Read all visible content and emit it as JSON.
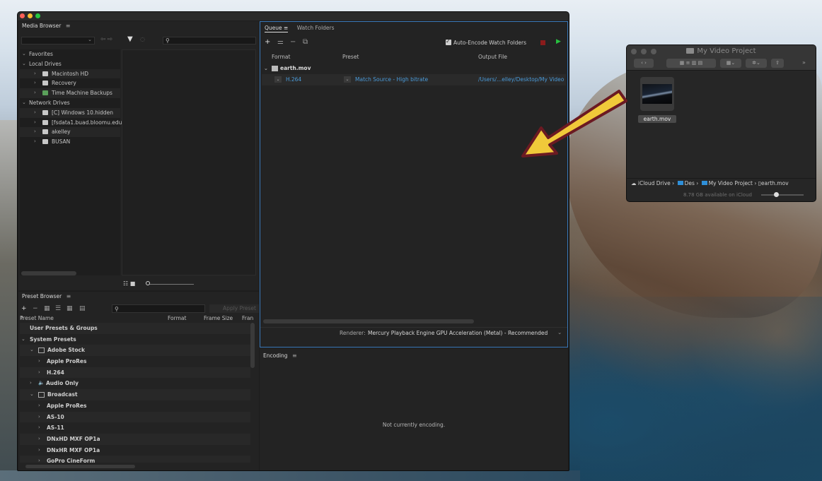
{
  "media_browser": {
    "title": "Media Browser",
    "menu_icon": "hamburger-icon",
    "search_placeholder": "",
    "tree": [
      {
        "label": "Favorites",
        "level": 0,
        "expanded": true
      },
      {
        "label": "Local Drives",
        "level": 0,
        "expanded": true
      },
      {
        "label": "Macintosh HD",
        "level": 1,
        "icon": "drive-icon"
      },
      {
        "label": "Recovery",
        "level": 1,
        "icon": "drive-icon"
      },
      {
        "label": "Time Machine Backups",
        "level": 1,
        "icon": "time-machine-icon"
      },
      {
        "label": "Network Drives",
        "level": 0,
        "expanded": true
      },
      {
        "label": "[C] Windows 10.hidden",
        "level": 1,
        "icon": "drive-icon"
      },
      {
        "label": "[fsdata1.buad.bloomu.edu",
        "level": 1,
        "icon": "drive-icon"
      },
      {
        "label": "akelley",
        "level": 1,
        "icon": "drive-icon"
      },
      {
        "label": "BUSAN",
        "level": 1,
        "icon": "drive-icon"
      }
    ]
  },
  "preset_browser": {
    "title": "Preset Browser",
    "apply_label": "Apply Preset",
    "columns": {
      "name": "Preset Name",
      "format": "Format",
      "frame_size": "Frame Size",
      "frame_rate": "Fran"
    },
    "rows": [
      {
        "label": "User Presets & Groups",
        "level": 0,
        "arrow": false
      },
      {
        "label": "System Presets",
        "level": 0,
        "arrow": true
      },
      {
        "label": "Adobe Stock",
        "level": 1,
        "arrow": true,
        "badge": "St"
      },
      {
        "label": "Apple ProRes",
        "level": 2,
        "arrow": true
      },
      {
        "label": "H.264",
        "level": 2,
        "arrow": true
      },
      {
        "label": "Audio Only",
        "level": 1,
        "arrow": true,
        "speaker": true
      },
      {
        "label": "Broadcast",
        "level": 1,
        "arrow": true,
        "badge": "TV"
      },
      {
        "label": "Apple ProRes",
        "level": 2,
        "arrow": true
      },
      {
        "label": "AS-10",
        "level": 2,
        "arrow": true
      },
      {
        "label": "AS-11",
        "level": 2,
        "arrow": true
      },
      {
        "label": "DNxHD MXF OP1a",
        "level": 2,
        "arrow": true
      },
      {
        "label": "DNxHR MXF OP1a",
        "level": 2,
        "arrow": true
      },
      {
        "label": "GoPro CineForm",
        "level": 2,
        "arrow": true
      }
    ]
  },
  "queue": {
    "tab_queue": "Queue",
    "tab_watch": "Watch Folders",
    "auto_encode_label": "Auto-Encode Watch Folders",
    "auto_encode_checked": true,
    "columns": {
      "format": "Format",
      "preset": "Preset",
      "output": "Output File"
    },
    "source_file": "earth.mov",
    "output": {
      "format": "H.264",
      "preset": "Match Source - High bitrate",
      "path": "/Users/...elley/Desktop/My Video"
    },
    "renderer_label": "Renderer:",
    "renderer_value": "Mercury Playback Engine GPU Acceleration (Metal) - Recommended"
  },
  "encoding": {
    "title": "Encoding",
    "status": "Not currently encoding."
  },
  "finder": {
    "title": "My Video Project",
    "file_name": "earth.mov",
    "path": [
      "iCloud Drive",
      "Des",
      "My Video Project",
      "earth.mov"
    ],
    "status": "8.78 GB available on iCloud"
  },
  "colors": {
    "queue_accent": "#3a78b9",
    "link_blue": "#4a9ad8",
    "play_green": "#27c13f",
    "stop_red": "#8b1b1b",
    "arrow_yellow": "#f0c93a",
    "arrow_outline": "#6b1a22"
  }
}
